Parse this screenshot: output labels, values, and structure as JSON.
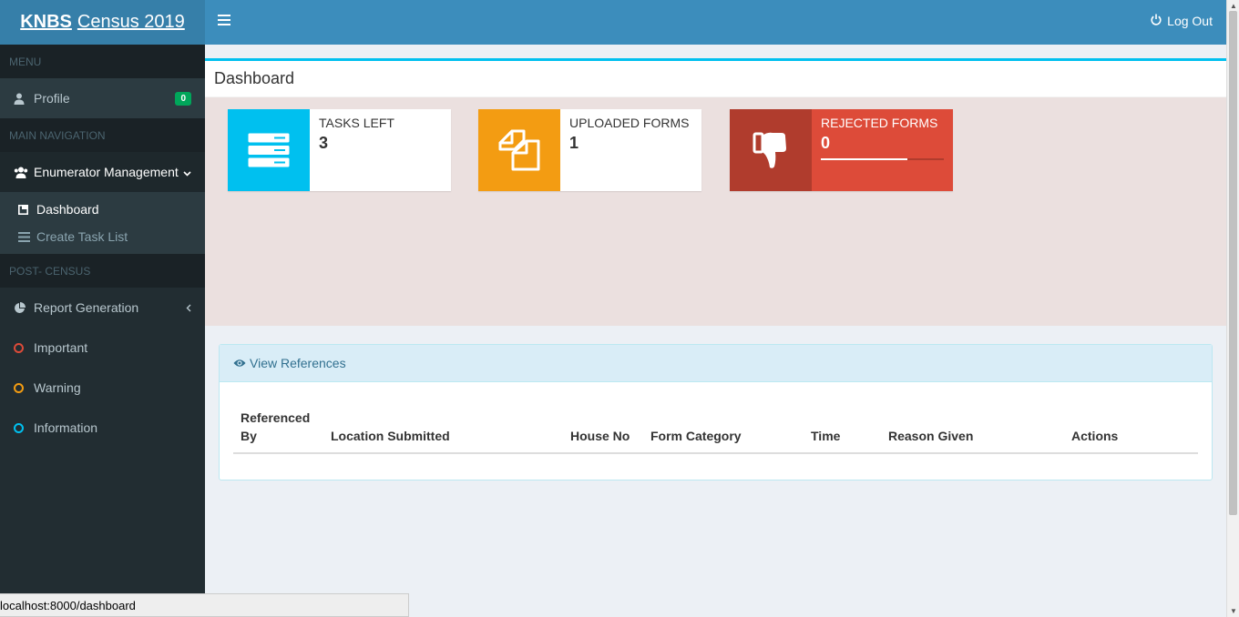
{
  "brand": {
    "bold": "KNBS",
    "rest": "Census 2019"
  },
  "navbar": {
    "logout_label": "Log Out"
  },
  "sidebar": {
    "menu_header": "MENU",
    "profile_label": "Profile",
    "profile_badge": "0",
    "main_nav_header": "MAIN NAVIGATION",
    "enumerator_label": "Enumerator Management",
    "sub_items": [
      {
        "label": "Dashboard"
      },
      {
        "label": "Create Task List"
      }
    ],
    "post_census_header": "POST- CENSUS",
    "report_label": "Report Generation",
    "labels": [
      {
        "label": "Important",
        "color": "#dd4b39"
      },
      {
        "label": "Warning",
        "color": "#f39c12"
      },
      {
        "label": "Information",
        "color": "#00c0ef"
      }
    ]
  },
  "dashboard": {
    "title": "Dashboard",
    "boxes": [
      {
        "label": "TASKS LEFT",
        "value": "3",
        "color": "#00c0ef"
      },
      {
        "label": "UPLOADED FORMS",
        "value": "1",
        "color": "#f39c12"
      },
      {
        "label": "REJECTED FORMS",
        "value": "0",
        "color": "#dd4b39",
        "progress": 0.7
      }
    ]
  },
  "references": {
    "heading": "View References",
    "columns": [
      "Referenced By",
      "Location Submitted",
      "House No",
      "Form Category",
      "Time",
      "Reason Given",
      "Actions"
    ]
  },
  "status_url": "localhost:8000/dashboard"
}
